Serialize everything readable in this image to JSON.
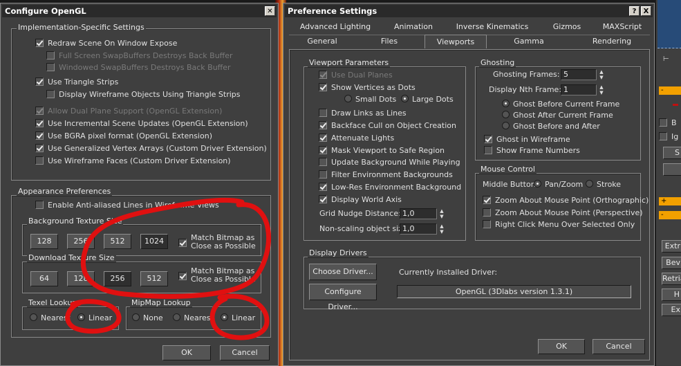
{
  "opengl": {
    "title": "Configure OpenGL",
    "impl_group": "Implementation-Specific Settings",
    "impl_items": [
      {
        "label": "Redraw Scene On Window Expose",
        "checked": true,
        "enabled": true
      },
      {
        "label": "Full Screen SwapBuffers Destroys Back Buffer",
        "checked": false,
        "enabled": false
      },
      {
        "label": "Windowed SwapBuffers Destroys Back Buffer",
        "checked": false,
        "enabled": false
      },
      {
        "label": "Use Triangle Strips",
        "checked": true,
        "enabled": true
      },
      {
        "label": "Display Wireframe Objects Using Triangle Strips",
        "checked": false,
        "enabled": true
      },
      {
        "label": "Allow Dual Plane Support (OpenGL Extension)",
        "checked": true,
        "enabled": false
      },
      {
        "label": "Use Incremental Scene Updates (OpenGL Extension)",
        "checked": true,
        "enabled": true
      },
      {
        "label": "Use BGRA pixel format (OpenGL Extension)",
        "checked": true,
        "enabled": true
      },
      {
        "label": "Use Generalized Vertex Arrays (Custom Driver Extension)",
        "checked": true,
        "enabled": true
      },
      {
        "label": "Use Wireframe Faces (Custom Driver Extension)",
        "checked": false,
        "enabled": true
      }
    ],
    "appearance_group": "Appearance Preferences",
    "antialias_label": "Enable Anti-aliased Lines in Wireframe Views",
    "bg_texture_group": "Background Texture Size",
    "bg_sizes": [
      "128",
      "256",
      "512",
      "1024"
    ],
    "dl_texture_group": "Download Texture Size",
    "dl_sizes": [
      "64",
      "128",
      "256",
      "512"
    ],
    "match_bitmap": "Match Bitmap as Close as Possible",
    "texel_group": "Texel Lookup",
    "mipmap_group": "MipMap Lookup",
    "nearest": "Nearest",
    "linear": "Linear",
    "none": "None",
    "ok": "OK",
    "cancel": "Cancel"
  },
  "prefs": {
    "title": "Preference Settings",
    "help_btn": "?",
    "close_btn": "X",
    "tabs_row1": [
      "Advanced Lighting",
      "Animation",
      "Inverse Kinematics",
      "Gizmos",
      "MAXScript"
    ],
    "tabs_row2": [
      "General",
      "Files",
      "Viewports",
      "Gamma",
      "Rendering"
    ],
    "viewport_group": "Viewport Parameters",
    "vp_dual": "Use Dual Planes",
    "vp_show_vertices": "Show Vertices as Dots",
    "vp_small_dots": "Small Dots",
    "vp_large_dots": "Large Dots",
    "vp_items": [
      {
        "label": "Draw Links as Lines",
        "checked": false
      },
      {
        "label": "Backface Cull on Object Creation",
        "checked": true
      },
      {
        "label": "Attenuate Lights",
        "checked": true
      },
      {
        "label": "Mask Viewport to Safe Region",
        "checked": true
      },
      {
        "label": "Update Background While Playing",
        "checked": false
      },
      {
        "label": "Filter Environment Backgrounds",
        "checked": false
      },
      {
        "label": "Low-Res Environment Background",
        "checked": true
      },
      {
        "label": "Display World Axis",
        "checked": true
      }
    ],
    "grid_nudge_label": "Grid Nudge Distance:",
    "grid_nudge_value": "1,0",
    "nonscaling_label": "Non-scaling object size:",
    "nonscaling_value": "1,0",
    "ghosting_group": "Ghosting",
    "ghost_frames_label": "Ghosting Frames:",
    "ghost_frames_value": "5",
    "nth_frame_label": "Display Nth Frame:",
    "nth_frame_value": "1",
    "ghost_before": "Ghost Before Current Frame",
    "ghost_after": "Ghost After Current Frame",
    "ghost_both": "Ghost Before and After",
    "ghost_wireframe": "Ghost in Wireframe",
    "show_frame_numbers": "Show Frame Numbers",
    "mouse_group": "Mouse Control",
    "middle_button": "Middle Button:",
    "pan_zoom": "Pan/Zoom",
    "stroke": "Stroke",
    "zoom_ortho": "Zoom About Mouse Point (Orthographic)",
    "zoom_persp": "Zoom About Mouse Point (Perspective)",
    "right_click_menu": "Right Click Menu Over Selected Only",
    "drivers_group": "Display Drivers",
    "choose_driver": "Choose Driver...",
    "configure_driver": "Configure Driver...",
    "installed_label": "Currently Installed Driver:",
    "installed_value": "OpenGL (3Dlabs version 1.3.1)",
    "ok": "OK",
    "cancel": "Cancel"
  },
  "right_panel": {
    "labels": [
      "B",
      "Ig",
      "S",
      "Extr",
      "Bev",
      "Retria",
      "H",
      "Ex"
    ]
  },
  "colors": {
    "annotation_red": "#e01010",
    "rollout_orange": "#f2a000"
  }
}
